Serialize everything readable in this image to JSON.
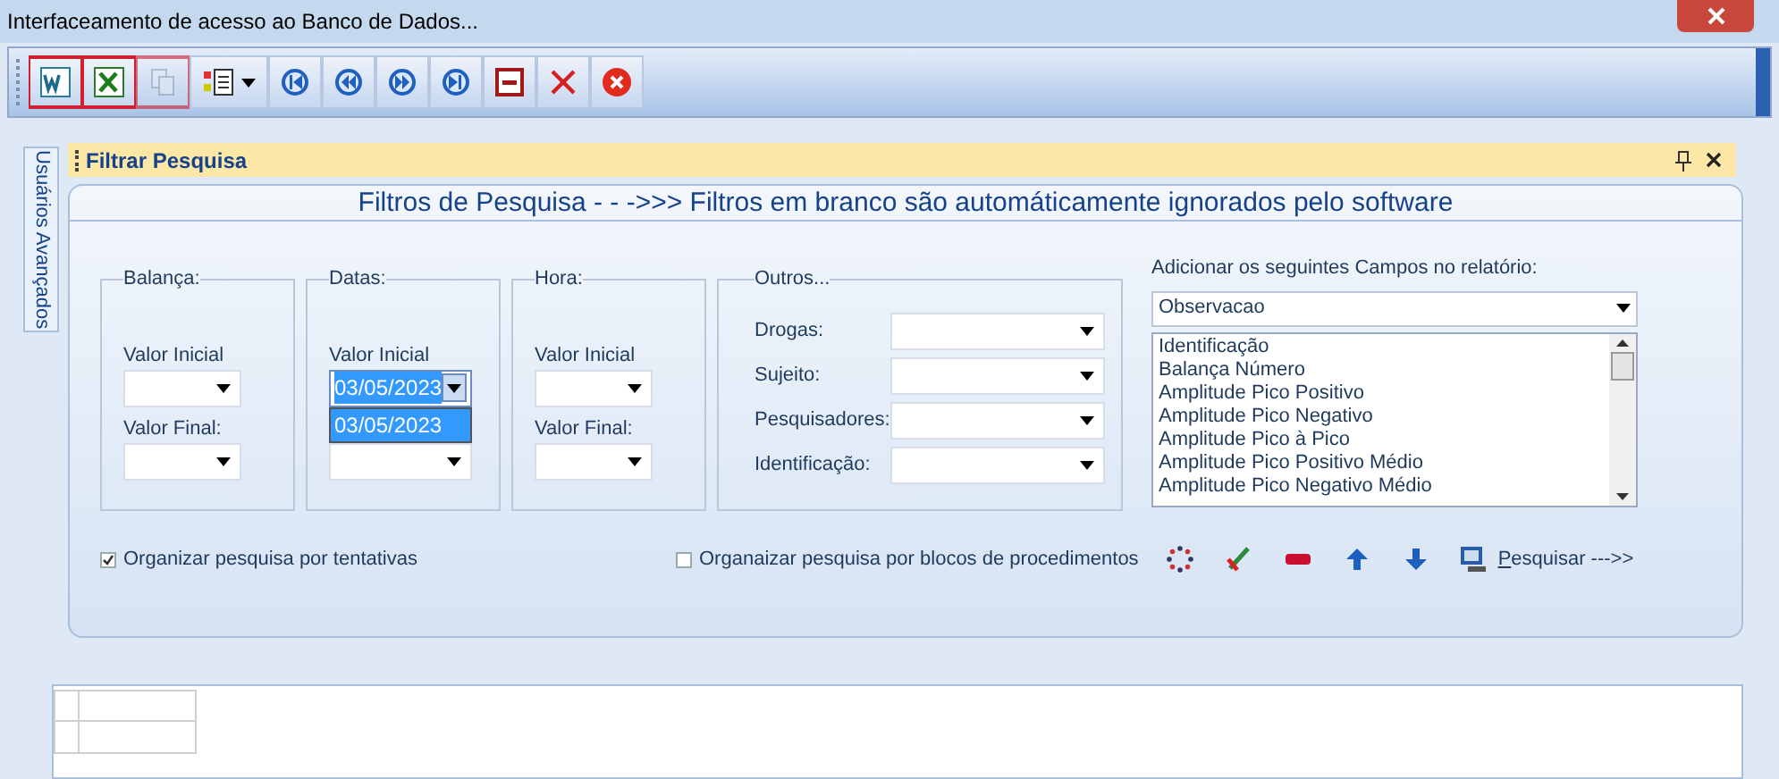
{
  "window": {
    "title": "Interfaceamento de acesso ao Banco de Dados..."
  },
  "toolbar": [
    {
      "kind": "word",
      "disabled": false,
      "highlighted": true
    },
    {
      "kind": "excel",
      "disabled": false,
      "highlighted": true
    },
    {
      "kind": "copy",
      "disabled": true,
      "highlighted": true
    },
    {
      "kind": "report",
      "disabled": false,
      "highlighted": false
    },
    {
      "kind": "first",
      "disabled": false,
      "highlighted": false
    },
    {
      "kind": "previous",
      "disabled": false,
      "highlighted": false
    },
    {
      "kind": "next",
      "disabled": false,
      "highlighted": false
    },
    {
      "kind": "last",
      "disabled": false,
      "highlighted": false
    },
    {
      "kind": "remove",
      "disabled": false,
      "highlighted": false
    },
    {
      "kind": "cancel",
      "disabled": false,
      "highlighted": false
    },
    {
      "kind": "close",
      "disabled": false,
      "highlighted": false
    }
  ],
  "side_tab": {
    "label": "Usuários Avançados"
  },
  "panel": {
    "title": "Filtrar Pesquisa",
    "heading": "Filtros de Pesquisa - - ->>> Filtros em branco são automáticamente ignorados pelo software",
    "groups": [
      {
        "title": "Balança:",
        "fields": [
          {
            "label": "Valor Inicial",
            "open": false
          },
          {
            "label": "Valor Final:",
            "open": false
          }
        ]
      },
      {
        "title": "Datas:",
        "fields": [
          {
            "label": "Valor Inicial",
            "value": "03/05/2023",
            "open": true,
            "options": [
              "03/05/2023"
            ]
          },
          {
            "open": false
          }
        ]
      },
      {
        "title": "Hora:",
        "fields": [
          {
            "label": "Valor Inicial",
            "open": false
          },
          {
            "label": "Valor Final:",
            "open": false
          }
        ]
      }
    ],
    "others": {
      "title": "Outros...",
      "fields": [
        {
          "label": "Drogas:"
        },
        {
          "label": "Sujeito:"
        },
        {
          "label": "Pesquisadores:"
        },
        {
          "label": "Identificação:"
        }
      ]
    },
    "report_fields": {
      "label": "Adicionar os seguintes Campos no relatório:",
      "value": "Observacao",
      "items": [
        "Identificação",
        "Balança Número",
        "Amplitude Pico Positivo",
        "Amplitude Pico Negativo",
        "Amplitude Pico à Pico",
        "Amplitude Pico Positivo Médio",
        "Amplitude Pico Negativo Médio"
      ]
    },
    "options": [
      {
        "label": "Organizar pesquisa por tentativas",
        "checked": true
      },
      {
        "label": "Organaizar pesquisa por blocos de procedimentos",
        "checked": false
      }
    ],
    "actions": [
      {
        "kind": "refresh"
      },
      {
        "kind": "clear"
      },
      {
        "kind": "minus"
      },
      {
        "kind": "up"
      },
      {
        "kind": "down"
      }
    ],
    "search_button": {
      "label": "Pesquisar --->>"
    }
  }
}
